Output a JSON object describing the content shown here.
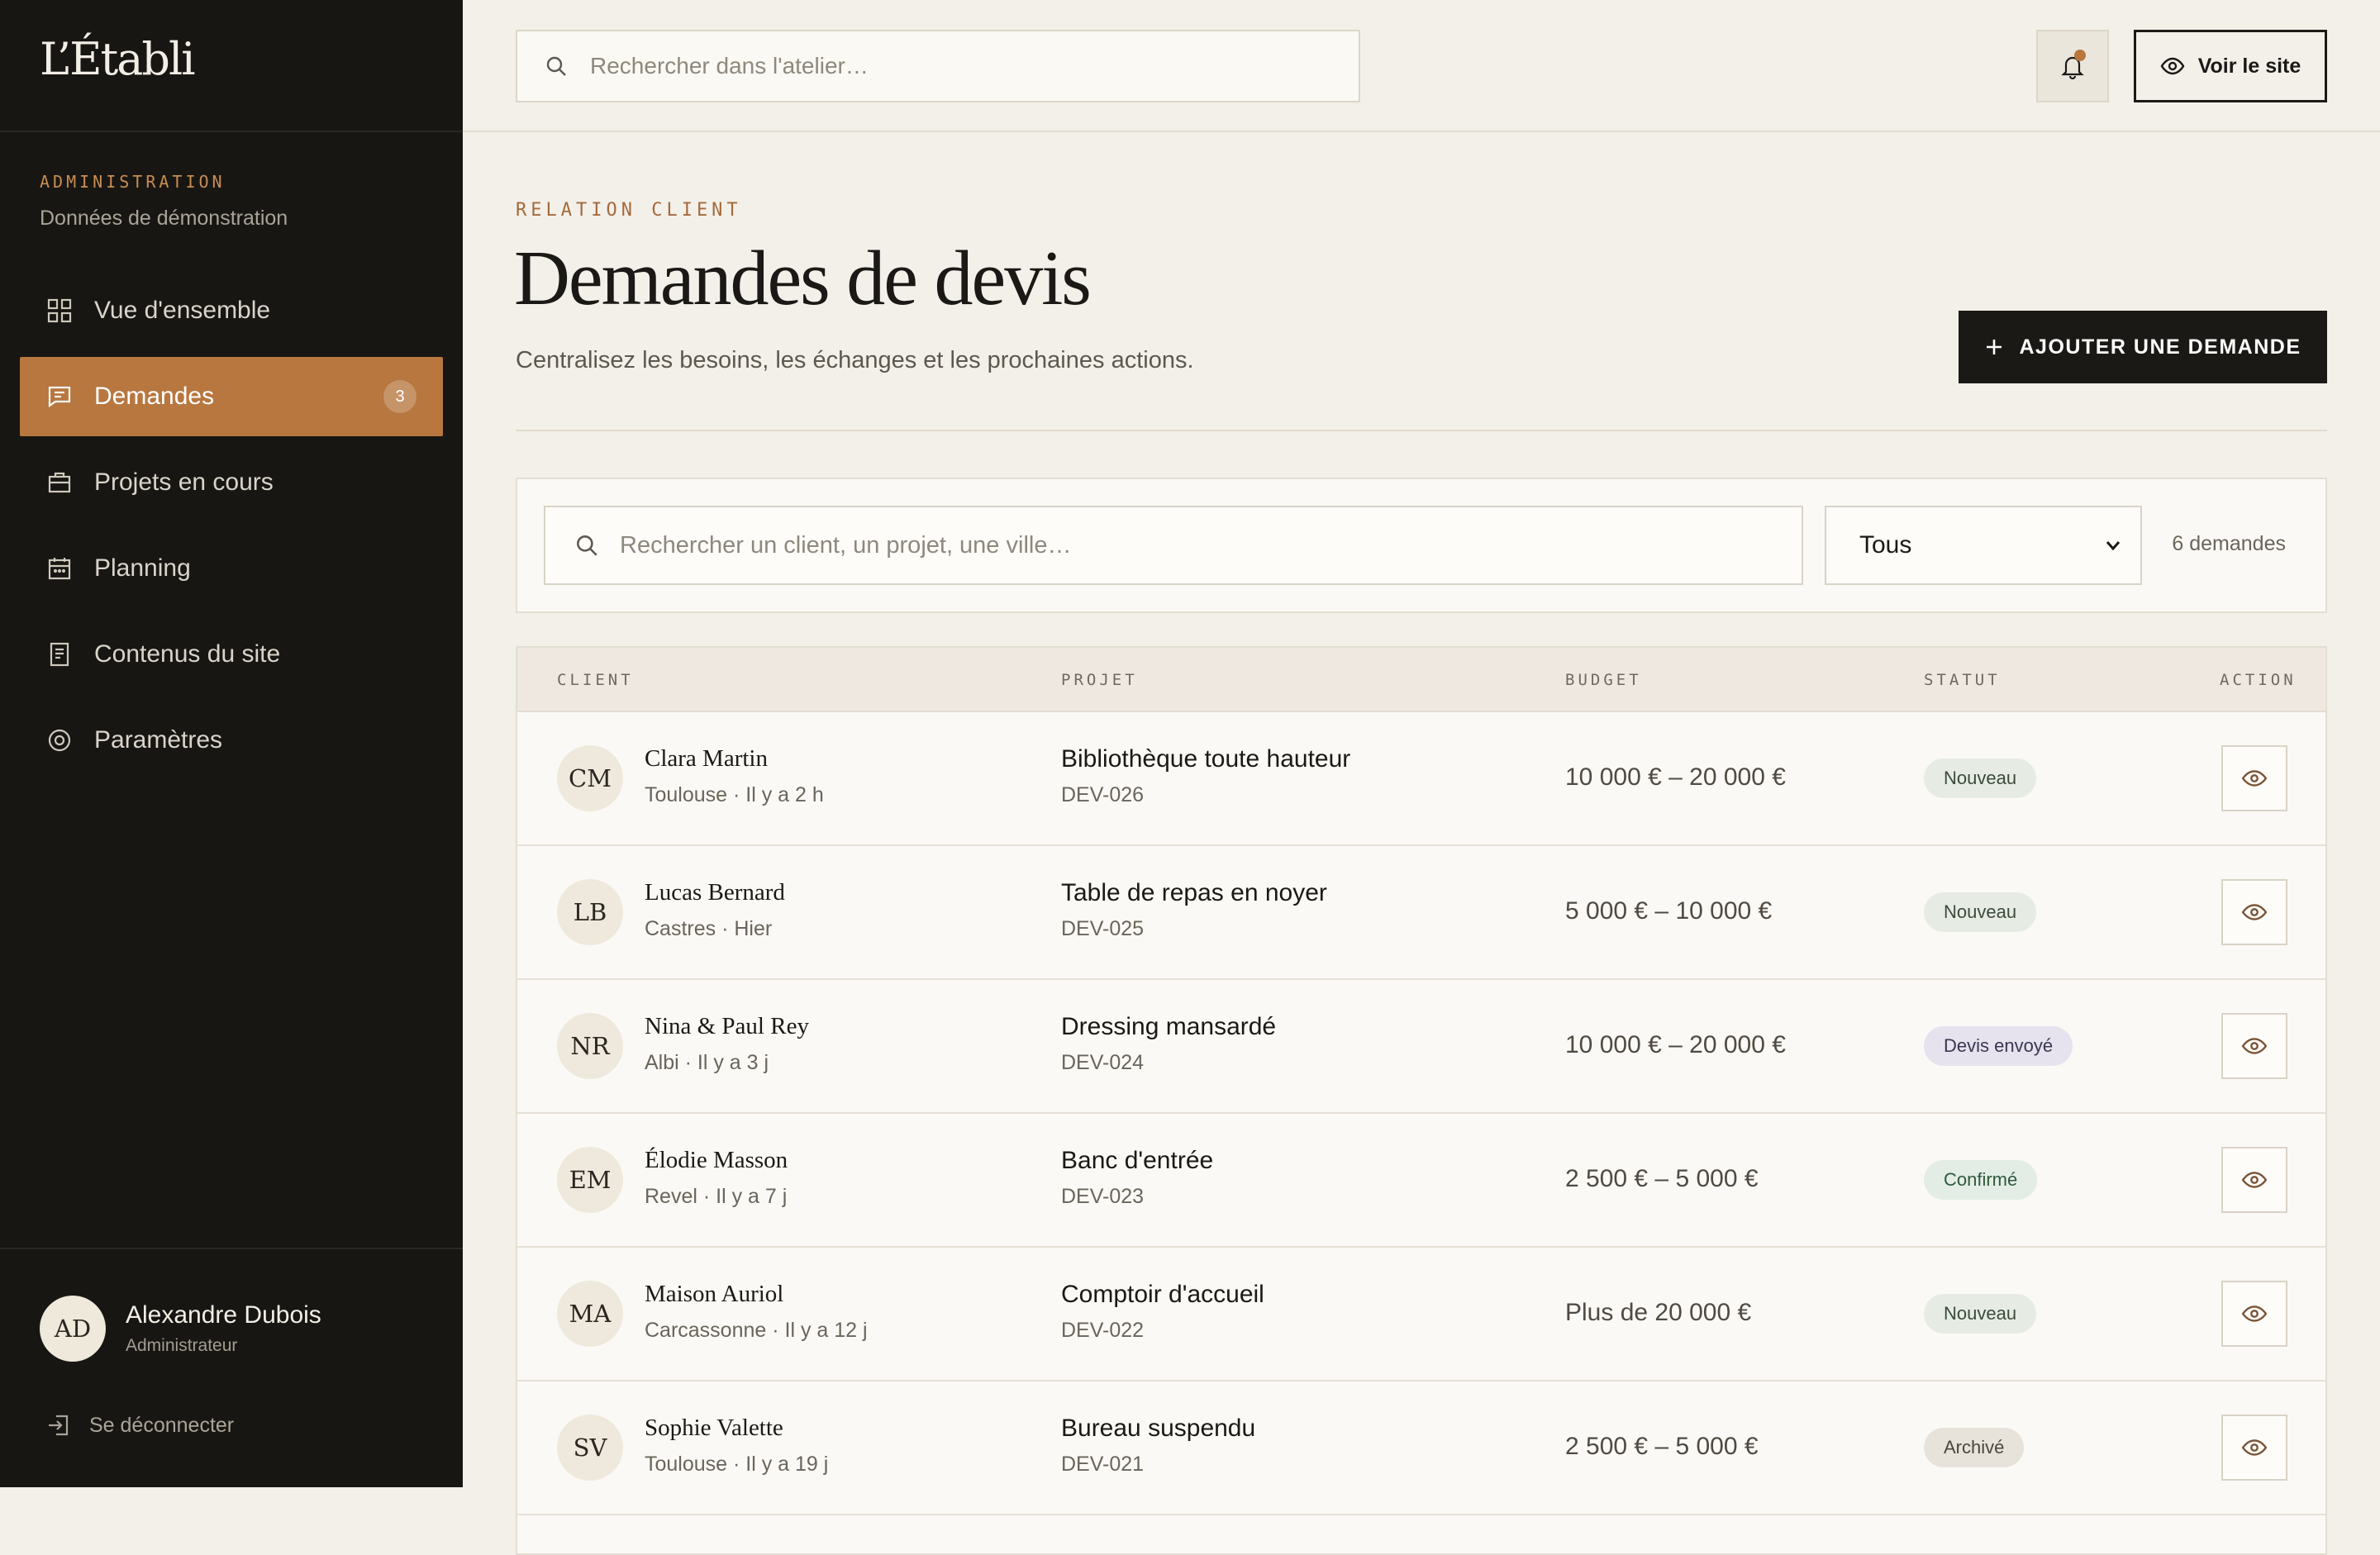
{
  "brand": "L’Établi",
  "admin": {
    "label": "ADMINISTRATION",
    "sub": "Données de démonstration"
  },
  "nav": [
    {
      "label": "Vue d'ensemble",
      "icon": "grid-icon"
    },
    {
      "label": "Demandes",
      "icon": "message-icon",
      "badge": "3",
      "active": true
    },
    {
      "label": "Projets en cours",
      "icon": "briefcase-icon"
    },
    {
      "label": "Planning",
      "icon": "calendar-icon"
    },
    {
      "label": "Contenus du site",
      "icon": "document-icon"
    },
    {
      "label": "Paramètres",
      "icon": "gear-icon"
    }
  ],
  "user": {
    "initials": "AD",
    "name": "Alexandre Dubois",
    "role": "Administrateur"
  },
  "logout": "Se déconnecter",
  "topbar": {
    "search_placeholder": "Rechercher dans l'atelier…",
    "view_site": "Voir le site"
  },
  "header": {
    "eyebrow": "RELATION CLIENT",
    "title": "Demandes de devis",
    "subtitle": "Centralisez les besoins, les échanges et les prochaines actions.",
    "add_button": "AJOUTER UNE DEMANDE"
  },
  "filter": {
    "search_placeholder": "Rechercher un client, un projet, une ville…",
    "select_value": "Tous",
    "count": "6 demandes"
  },
  "table": {
    "columns": [
      "CLIENT",
      "PROJET",
      "BUDGET",
      "STATUT",
      "ACTION"
    ],
    "rows": [
      {
        "initials": "CM",
        "client": "Clara Martin",
        "meta": "Toulouse · Il y a 2 h",
        "project": "Bibliothèque toute hauteur",
        "ref": "DEV-026",
        "budget": "10 000 € – 20 000 €",
        "status": "Nouveau"
      },
      {
        "initials": "LB",
        "client": "Lucas Bernard",
        "meta": "Castres · Hier",
        "project": "Table de repas en noyer",
        "ref": "DEV-025",
        "budget": "5 000 € – 10 000 €",
        "status": "Nouveau"
      },
      {
        "initials": "NR",
        "client": "Nina & Paul Rey",
        "meta": "Albi · Il y a 3 j",
        "project": "Dressing mansardé",
        "ref": "DEV-024",
        "budget": "10 000 € – 20 000 €",
        "status": "Devis envoyé"
      },
      {
        "initials": "EM",
        "client": "Élodie Masson",
        "meta": "Revel · Il y a 7 j",
        "project": "Banc d'entrée",
        "ref": "DEV-023",
        "budget": "2 500 € – 5 000 €",
        "status": "Confirmé"
      },
      {
        "initials": "MA",
        "client": "Maison Auriol",
        "meta": "Carcassonne · Il y a 12 j",
        "project": "Comptoir d'accueil",
        "ref": "DEV-022",
        "budget": "Plus de 20 000 €",
        "status": "Nouveau"
      },
      {
        "initials": "SV",
        "client": "Sophie Valette",
        "meta": "Toulouse · Il y a 19 j",
        "project": "Bureau suspendu",
        "ref": "DEV-021",
        "budget": "2 500 € – 5 000 €",
        "status": "Archivé"
      }
    ]
  },
  "colors": {
    "accent": "#b7773f",
    "sidebar": "#181613",
    "background": "#f3f0e9"
  }
}
